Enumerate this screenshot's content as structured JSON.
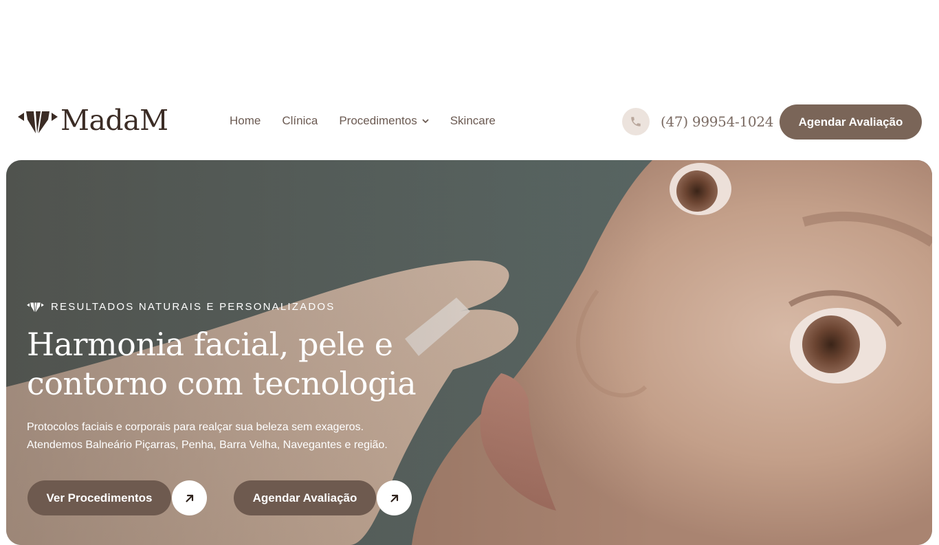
{
  "brand": {
    "name": "MadaM",
    "logo_icon": "diamond-logo-icon"
  },
  "nav": {
    "items": [
      {
        "label": "Home"
      },
      {
        "label": "Clínica"
      },
      {
        "label": "Procedimentos",
        "has_dropdown": true
      },
      {
        "label": "Skincare"
      }
    ]
  },
  "contact": {
    "phone_icon": "phone-icon",
    "phone": "(47) 99954-1024"
  },
  "header_cta": {
    "label": "Agendar Avaliação"
  },
  "hero": {
    "eyebrow": "RESULTADOS NATURAIS E PERSONALIZADOS",
    "title_line1": "Harmonia facial, pele e",
    "title_line2": "contorno com tecnologia",
    "subtitle_line1": "Protocolos faciais e corporais para realçar sua beleza sem exageros.",
    "subtitle_line2": "Atendemos Balneário Piçarras, Penha, Barra Velha, Navegantes e região.",
    "primary_button": "Ver Procedimentos",
    "secondary_button": "Agendar Avaliação",
    "arrow_icon": "arrow-up-right-icon"
  },
  "colors": {
    "brand_brown": "#7a6558",
    "button_brown": "#6e5a4f",
    "logo_dark": "#3b2c25",
    "nav_text": "#6b5a52",
    "phone_bg": "#ece3dd"
  }
}
